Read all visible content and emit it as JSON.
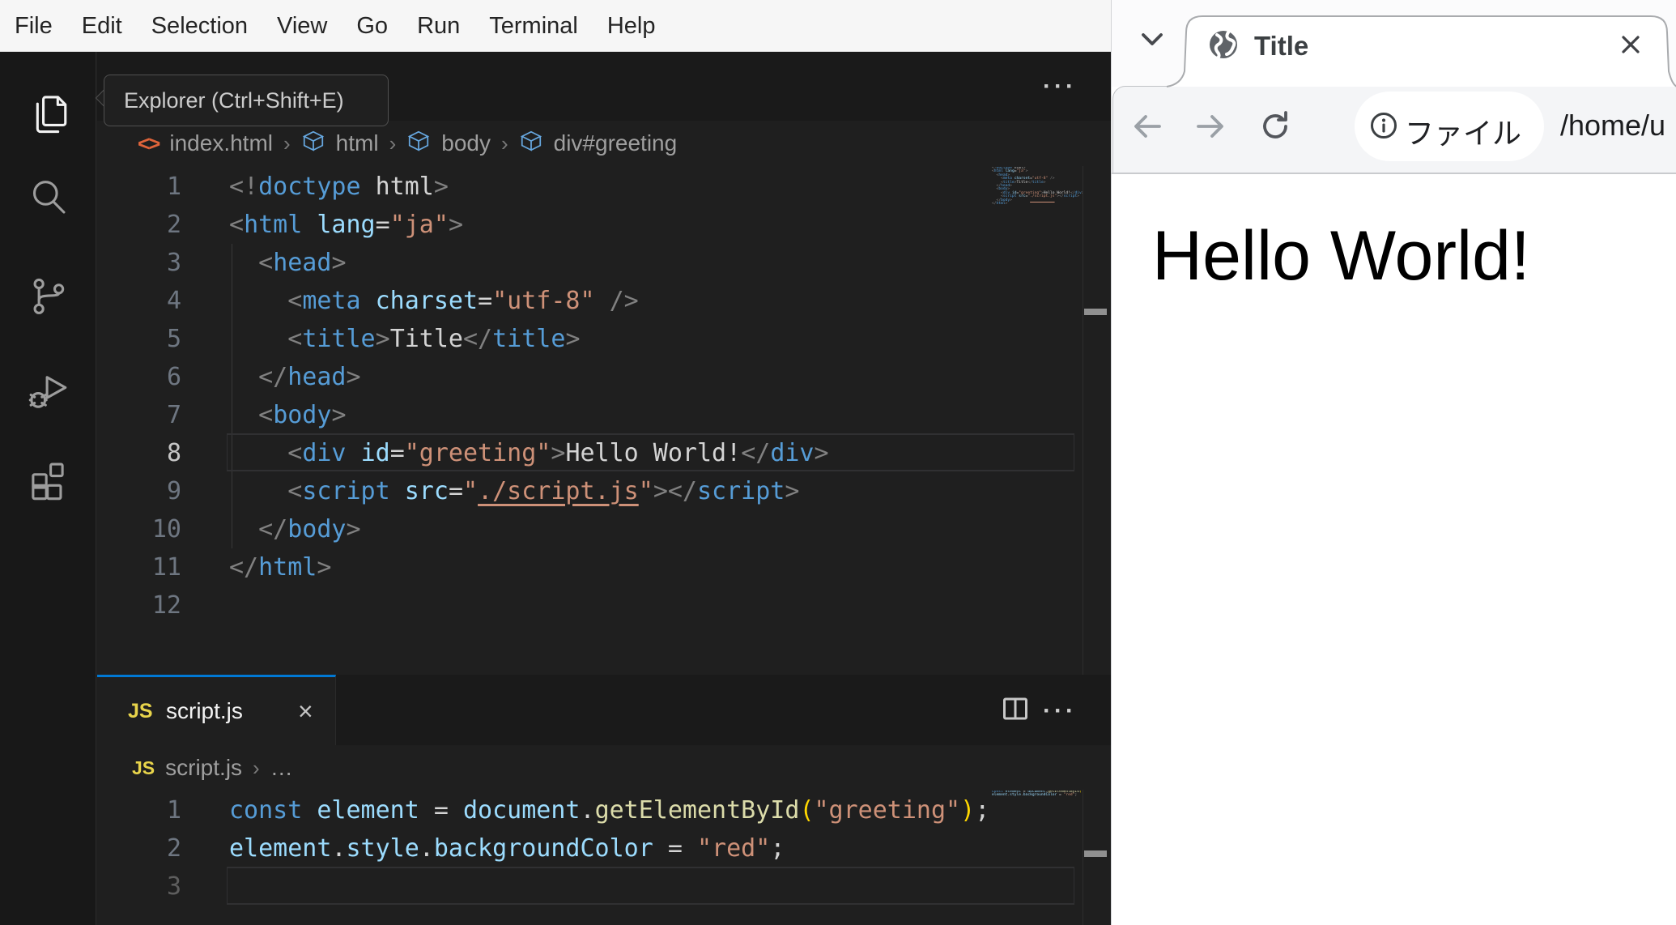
{
  "colors": {
    "accent_blue": "#0078d4",
    "banner_red": "#ee3424",
    "editor_bg": "#1f1f1f",
    "tabstrip_bg": "#1a1a1a",
    "menubar_bg": "#f6f6f6"
  },
  "menubar": {
    "items": [
      "File",
      "Edit",
      "Selection",
      "View",
      "Go",
      "Run",
      "Terminal",
      "Help"
    ]
  },
  "activitybar": {
    "icons": [
      "explorer-icon",
      "search-icon",
      "source-control-icon",
      "run-debug-icon",
      "extensions-icon"
    ]
  },
  "tooltip": {
    "text": "Explorer (Ctrl+Shift+E)"
  },
  "top_editor": {
    "actions": {
      "more_label": "···"
    },
    "breadcrumbs": {
      "file": "index.html",
      "separator": "›",
      "path": [
        "html",
        "body",
        "div#greeting"
      ],
      "file_icon": "<>"
    },
    "active_line": 8,
    "lines": [
      {
        "n": 1,
        "tokens": [
          [
            "punct",
            "<!"
          ],
          [
            "tag",
            "doctype"
          ],
          [
            "text",
            " html"
          ],
          [
            "punct",
            ">"
          ]
        ]
      },
      {
        "n": 2,
        "tokens": [
          [
            "punct",
            "<"
          ],
          [
            "tag",
            "html"
          ],
          [
            "text",
            " "
          ],
          [
            "attr",
            "lang"
          ],
          [
            "text",
            "="
          ],
          [
            "str",
            "\"ja\""
          ],
          [
            "punct",
            ">"
          ]
        ]
      },
      {
        "n": 3,
        "tokens": [
          [
            "text",
            "  "
          ],
          [
            "punct",
            "<"
          ],
          [
            "tag",
            "head"
          ],
          [
            "punct",
            ">"
          ]
        ]
      },
      {
        "n": 4,
        "tokens": [
          [
            "text",
            "    "
          ],
          [
            "punct",
            "<"
          ],
          [
            "tag",
            "meta"
          ],
          [
            "text",
            " "
          ],
          [
            "attr",
            "charset"
          ],
          [
            "text",
            "="
          ],
          [
            "str",
            "\"utf-8\""
          ],
          [
            "text",
            " "
          ],
          [
            "punct",
            "/>"
          ]
        ]
      },
      {
        "n": 5,
        "tokens": [
          [
            "text",
            "    "
          ],
          [
            "punct",
            "<"
          ],
          [
            "tag",
            "title"
          ],
          [
            "punct",
            ">"
          ],
          [
            "text",
            "Title"
          ],
          [
            "punct",
            "</"
          ],
          [
            "tag",
            "title"
          ],
          [
            "punct",
            ">"
          ]
        ]
      },
      {
        "n": 6,
        "tokens": [
          [
            "text",
            "  "
          ],
          [
            "punct",
            "</"
          ],
          [
            "tag",
            "head"
          ],
          [
            "punct",
            ">"
          ]
        ]
      },
      {
        "n": 7,
        "tokens": [
          [
            "text",
            "  "
          ],
          [
            "punct",
            "<"
          ],
          [
            "tag",
            "body"
          ],
          [
            "punct",
            ">"
          ]
        ]
      },
      {
        "n": 8,
        "tokens": [
          [
            "text",
            "    "
          ],
          [
            "punct",
            "<"
          ],
          [
            "tag",
            "div"
          ],
          [
            "text",
            " "
          ],
          [
            "attr",
            "id"
          ],
          [
            "text",
            "="
          ],
          [
            "str",
            "\"greeting\""
          ],
          [
            "punct",
            ">"
          ],
          [
            "text",
            "Hello World!"
          ],
          [
            "punct",
            "</"
          ],
          [
            "tag",
            "div"
          ],
          [
            "punct",
            ">"
          ]
        ]
      },
      {
        "n": 9,
        "tokens": [
          [
            "text",
            "    "
          ],
          [
            "punct",
            "<"
          ],
          [
            "tag",
            "script"
          ],
          [
            "text",
            " "
          ],
          [
            "attr",
            "src"
          ],
          [
            "text",
            "="
          ],
          [
            "str",
            "\""
          ],
          [
            "link",
            "./script.js"
          ],
          [
            "str",
            "\""
          ],
          [
            "punct",
            "></"
          ],
          [
            "tag",
            "script"
          ],
          [
            "punct",
            ">"
          ]
        ]
      },
      {
        "n": 10,
        "tokens": [
          [
            "text",
            "  "
          ],
          [
            "punct",
            "</"
          ],
          [
            "tag",
            "body"
          ],
          [
            "punct",
            ">"
          ]
        ]
      },
      {
        "n": 11,
        "tokens": [
          [
            "punct",
            "</"
          ],
          [
            "tag",
            "html"
          ],
          [
            "punct",
            ">"
          ]
        ]
      },
      {
        "n": 12,
        "tokens": []
      }
    ],
    "indent_guide": {
      "from_line": 3,
      "to_line": 10
    }
  },
  "bottom_editor": {
    "tab": {
      "label": "script.js",
      "icon": "JS",
      "close_label": "×"
    },
    "actions": {
      "more_label": "···"
    },
    "breadcrumbs": {
      "file": "script.js",
      "separator": "›",
      "ellipsis": "…",
      "file_icon": "JS"
    },
    "active_line": 3,
    "lines": [
      {
        "n": 1,
        "tokens": [
          [
            "kw",
            "const"
          ],
          [
            "text",
            " "
          ],
          [
            "var",
            "element"
          ],
          [
            "text",
            " = "
          ],
          [
            "var",
            "document"
          ],
          [
            "text",
            "."
          ],
          [
            "fn",
            "getElementById"
          ],
          [
            "paren",
            "("
          ],
          [
            "str",
            "\"greeting\""
          ],
          [
            "paren",
            ")"
          ],
          [
            "text",
            ";"
          ]
        ]
      },
      {
        "n": 2,
        "tokens": [
          [
            "var",
            "element"
          ],
          [
            "text",
            "."
          ],
          [
            "var",
            "style"
          ],
          [
            "text",
            "."
          ],
          [
            "var",
            "backgroundColor"
          ],
          [
            "text",
            " = "
          ],
          [
            "str",
            "\"red\""
          ],
          [
            "text",
            ";"
          ]
        ]
      },
      {
        "n": 3,
        "tokens": []
      }
    ]
  },
  "browser": {
    "tab": {
      "title": "Title",
      "close_label": "×"
    },
    "toolbar": {
      "chip_label": "ファイル",
      "url": "/home/u"
    },
    "page": {
      "greeting_text": "Hello World!"
    }
  }
}
